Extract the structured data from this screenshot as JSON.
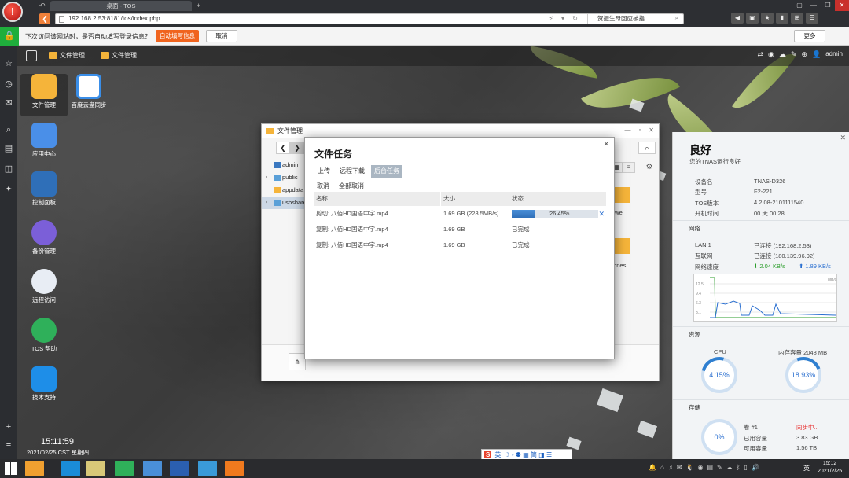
{
  "browser": {
    "logo": "!",
    "tab_title": "桌面 - TOS",
    "tab_back": "↶",
    "tab_add": "+",
    "window_controls": [
      "▢",
      "—",
      "❐",
      "✕"
    ],
    "address": "192.168.2.53:8181/tos/index.php",
    "address_tools": "⚡ ▾ ↻",
    "search_text": "贺振生母回应被指...",
    "toolbar_icons": [
      "◀",
      "▣",
      "★",
      "▮",
      "⊞",
      "☰",
      "—",
      "❐",
      "✕"
    ]
  },
  "notification": {
    "message": "下次访问该网站时，是否自动填写登录信息？",
    "autofill_label": "自动填写信息",
    "cancel_label": "取消",
    "more_label": "更多"
  },
  "side_rail_icons": [
    "☆",
    "◷",
    "✉",
    "⌕",
    "▤",
    "◫",
    "✦",
    "+",
    "≡"
  ],
  "tos": {
    "tabs": [
      "文件管理",
      "文件管理"
    ],
    "top_right_icons": [
      "⇄",
      "◉",
      "☁",
      "✎",
      "⊕",
      "👤"
    ],
    "user": "admin",
    "desktop_icons": [
      {
        "label": "文件管理",
        "color": "#f5b43a"
      },
      {
        "label": "百度云盘同步",
        "color": "#ffffff"
      },
      {
        "label": "应用中心",
        "color": "#4a8fe8"
      },
      {
        "label": "控制面板",
        "color": "#2f6fb8"
      },
      {
        "label": "备份管理",
        "color": "#7b5fd8"
      },
      {
        "label": "远程访问",
        "color": "#e8edf4"
      },
      {
        "label": "TOS 帮助",
        "color": "#2fb05a"
      },
      {
        "label": "技术支持",
        "color": "#1e8ee8"
      }
    ],
    "clock_time": "15:11:59",
    "clock_date": "2021/02/25 CST 星期四"
  },
  "ime_bar": {
    "logo": "S",
    "lang": "英",
    "icons": "☽ ◦ ⚉ ▦ 简 ◨ ☰"
  },
  "file_manager": {
    "title": "文件管理",
    "win_buttons": [
      "—",
      "▫",
      "✕"
    ],
    "nav_back": "❮",
    "nav_forward": "❯",
    "search_icon": "⌕",
    "sidebar": [
      {
        "label": "admin",
        "type": "user",
        "arrow": ""
      },
      {
        "label": "public",
        "type": "folder",
        "arrow": "›"
      },
      {
        "label": "appdata",
        "type": "folder",
        "arrow": ""
      },
      {
        "label": "usbshare",
        "type": "share",
        "arrow": "›"
      }
    ],
    "folder_labels": [
      "awei",
      "tones"
    ],
    "view_icons": [
      "▦",
      "≡"
    ],
    "gear_icon": "⚙",
    "share_icon": "⋔"
  },
  "task_dialog": {
    "title": "文件任务",
    "close": "✕",
    "tabs": [
      "上传",
      "远程下载",
      "后台任务"
    ],
    "actions": [
      "取消",
      "全部取消"
    ],
    "columns": [
      "名称",
      "大小",
      "状态"
    ],
    "rows": [
      {
        "name": "剪切: 八佰HD国语中字.mp4",
        "size": "1.69 GB (228.5MB/s)",
        "status": "26.45%",
        "progress": 0.2645,
        "cancel": "✕"
      },
      {
        "name": "复制: 八佰HD国语中字.mp4",
        "size": "1.69 GB",
        "status": "已完成"
      },
      {
        "name": "复制: 八佰HD国语中字.mp4",
        "size": "1.69 GB",
        "status": "已完成"
      }
    ]
  },
  "status_panel": {
    "close": "✕",
    "title": "良好",
    "subtitle": "您的TNAS运行良好",
    "device": [
      {
        "k": "设备名",
        "v": "TNAS-D326"
      },
      {
        "k": "型号",
        "v": "F2-221"
      },
      {
        "k": "TOS版本",
        "v": "4.2.08-2101111540"
      },
      {
        "k": "开机时间",
        "v": "00 天 00:28"
      }
    ],
    "network_title": "网络",
    "network": [
      {
        "k": "LAN 1",
        "v": "已连接 (192.168.2.53)"
      },
      {
        "k": "互联网",
        "v": "已连接 (180.139.96.92)"
      },
      {
        "k": "网络速度",
        "v": ""
      }
    ],
    "speed_down": "⬇ 2.04 KB/s",
    "speed_up": "⬆ 1.89 KB/s",
    "graph_unit": "MB/s",
    "graph_ticks": [
      "12.5",
      "9.4",
      "6.3",
      "3.1"
    ],
    "resource_title": "资源",
    "cpu_label": "CPU",
    "cpu_value": "4.15%",
    "cpu_fraction": 0.0415,
    "mem_label": "内存容量 2048 MB",
    "mem_value": "18.93%",
    "mem_fraction": 0.1893,
    "storage_title": "存储",
    "storage_gauge": "0%",
    "storage": [
      {
        "k": "卷 #1",
        "v": "同步中..."
      },
      {
        "k": "已用容量",
        "v": "3.83 GB"
      },
      {
        "k": "可用容量",
        "v": "1.56 TB"
      }
    ],
    "colors": {
      "accent": "#2f7fd0",
      "down": "#2b9d2b",
      "sync": "#e83030"
    }
  },
  "taskbar": {
    "apps": [
      "#f0a030",
      "#1a8cd8",
      "#d8c878",
      "#2fb05a",
      "#4a8fd8",
      "#2b5fb0",
      "#3a9ad8",
      "#f07a1e"
    ],
    "tray_icons": [
      "🔔",
      "⌂",
      "♫",
      "✉",
      "🐧",
      "◉",
      "▤",
      "✎",
      "☁",
      "ᛒ",
      "▯",
      "🔊"
    ],
    "ime": "英",
    "time": "15:12",
    "date": "2021/2/25"
  }
}
